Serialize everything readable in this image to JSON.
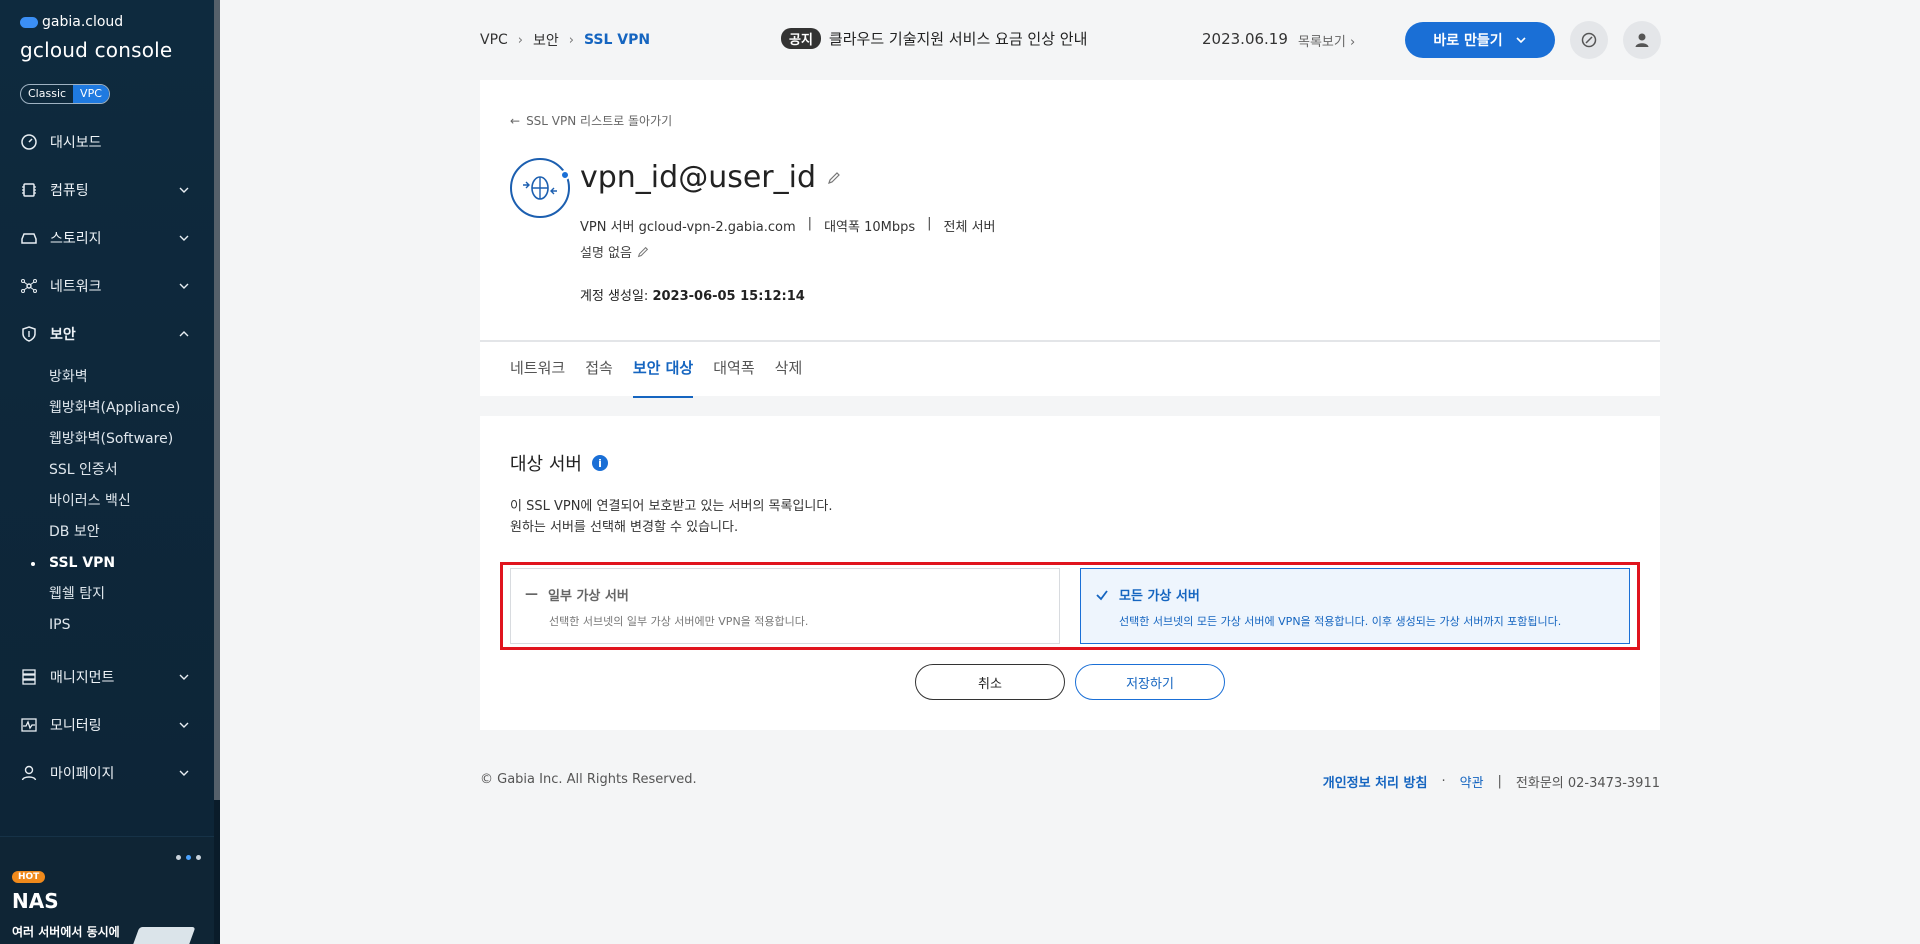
{
  "sidebar": {
    "brand_top": "gabia.cloud",
    "brand_main": "gcloud console",
    "mode_classic": "Classic",
    "mode_vpc": "VPC",
    "items": [
      {
        "label": "대시보드"
      },
      {
        "label": "컴퓨팅"
      },
      {
        "label": "스토리지"
      },
      {
        "label": "네트워크"
      },
      {
        "label": "보안"
      },
      {
        "label": "매니지먼트"
      },
      {
        "label": "모니터링"
      },
      {
        "label": "마이페이지"
      }
    ],
    "security_sub": [
      {
        "label": "방화벽"
      },
      {
        "label": "웹방화벽(Appliance)"
      },
      {
        "label": "웹방화벽(Software)"
      },
      {
        "label": "SSL 인증서"
      },
      {
        "label": "바이러스 백신"
      },
      {
        "label": "DB 보안"
      },
      {
        "label": "SSL VPN"
      },
      {
        "label": "웹쉘 탐지"
      },
      {
        "label": "IPS"
      }
    ],
    "promo": {
      "badge": "HOT",
      "title": "NAS",
      "desc": "여러 서버에서 동시에"
    }
  },
  "header": {
    "breadcrumb": [
      "VPC",
      "보안",
      "SSL VPN"
    ],
    "notice_badge": "공지",
    "notice_text": "클라우드 기술지원 서비스 요금 인상 안내",
    "notice_date": "2023.06.19",
    "notice_more": "목록보기",
    "create_label": "바로 만들기"
  },
  "detail": {
    "back_link": "SSL VPN 리스트로 돌아가기",
    "title": "vpn_id@user_id",
    "meta_server": "VPN 서버 gcloud-vpn-2.gabia.com",
    "meta_bandwidth": "대역폭 10Mbps",
    "meta_scope": "전체 서버",
    "description": "설명 없음",
    "created_label": "계정 생성일:",
    "created_value": "2023-06-05 15:12:14",
    "tabs": [
      "네트워크",
      "접속",
      "보안 대상",
      "대역폭",
      "삭제"
    ]
  },
  "target": {
    "title": "대상 서버",
    "desc1": "이 SSL VPN에 연결되어 보호받고 있는 서버의 목록입니다.",
    "desc2": "원하는 서버를 선택해 변경할 수 있습니다.",
    "opt1_title": "일부 가상 서버",
    "opt1_desc": "선택한 서브넷의 일부 가상 서버에만 VPN을 적용합니다.",
    "opt2_title": "모든 가상 서버",
    "opt2_desc": "선택한 서브넷의 모든 가상 서버에 VPN을 적용합니다. 이후 생성되는 가상 서버까지 포함됩니다.",
    "cancel": "취소",
    "save": "저장하기"
  },
  "footer": {
    "copyright": "© Gabia Inc. All Rights Reserved.",
    "privacy": "개인정보 처리 방침",
    "dot": "·",
    "terms": "약관",
    "bar": "|",
    "phone": "전화문의  02-3473-3911"
  },
  "colors": {
    "accent": "#1a6fd6",
    "sidebar_bg": "#0e2a3e",
    "highlight": "#e0141e"
  }
}
